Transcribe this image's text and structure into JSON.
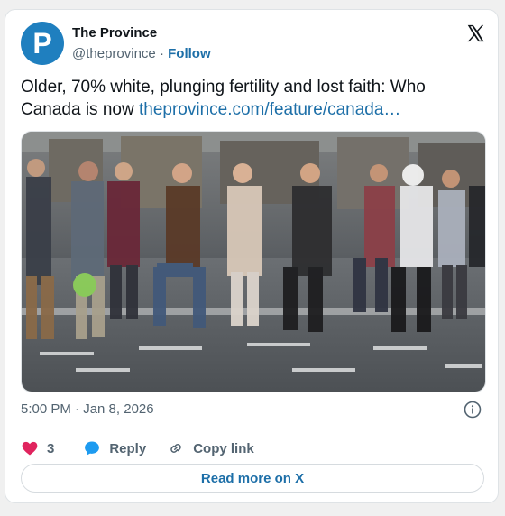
{
  "account": {
    "avatar_letter": "P",
    "name": "The Province",
    "handle": "@theprovince",
    "separator": "·",
    "follow_label": "Follow"
  },
  "tweet": {
    "text": "Older, 70% white, plunging fertility and lost faith: Who Canada is now",
    "link_text": "theprovince.com/feature/canada…",
    "timestamp": "5:00 PM · Jan 8, 2026"
  },
  "actions": {
    "like_count": "3",
    "reply_label": "Reply",
    "copy_link_label": "Copy link",
    "read_more_label": "Read more on X"
  },
  "icons": {
    "brand": "x-logo-icon",
    "like": "heart-icon",
    "reply": "speech-bubble-icon",
    "copy": "link-icon",
    "info": "info-icon"
  },
  "colors": {
    "avatar": "#1f7fbf",
    "link": "#1d6fa8",
    "like": "#e0245e",
    "reply": "#1d9bf0",
    "muted": "#536471"
  },
  "media": {
    "description_icon": "photo-image"
  }
}
